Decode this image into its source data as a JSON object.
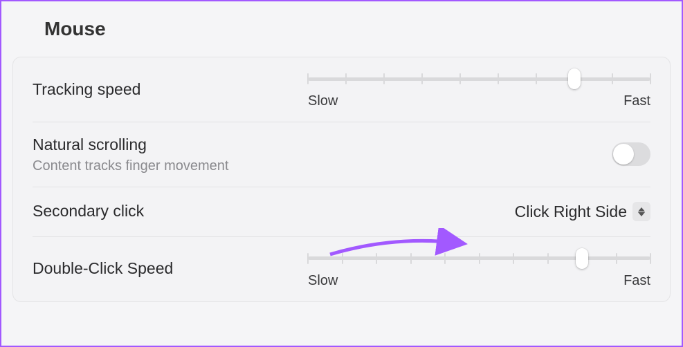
{
  "title": "Mouse",
  "rows": {
    "tracking": {
      "label": "Tracking speed",
      "min_label": "Slow",
      "max_label": "Fast",
      "ticks": 10,
      "value_index": 7
    },
    "scrolling": {
      "label": "Natural scrolling",
      "sublabel": "Content tracks finger movement",
      "enabled": false
    },
    "secondary": {
      "label": "Secondary click",
      "value": "Click Right Side"
    },
    "doubleclick": {
      "label": "Double-Click Speed",
      "min_label": "Slow",
      "max_label": "Fast",
      "ticks": 11,
      "value_index": 8
    }
  },
  "annotation": {
    "color": "#a259ff"
  }
}
